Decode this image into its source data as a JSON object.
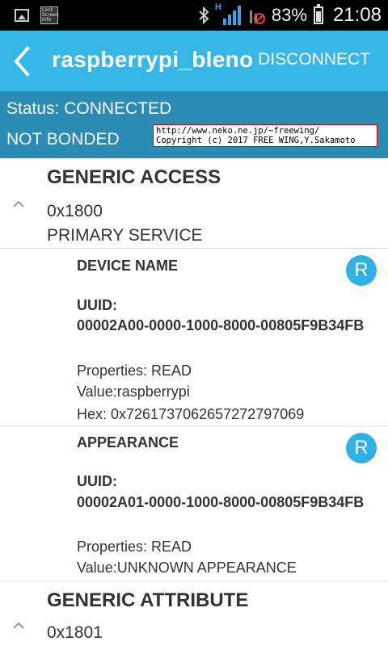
{
  "status_bar": {
    "lock_screen_text": "Lock Screen Info",
    "battery_percent": "83%",
    "time": "21:08",
    "signal_label": "H"
  },
  "app_bar": {
    "title": "raspberrypi_bleno",
    "action": "DISCONNECT"
  },
  "connection": {
    "status": "Status: CONNECTED",
    "bond": "NOT BONDED",
    "credit_line1": "http://www.neko.ne.jp/~freewing/",
    "credit_line2": "Copyright (c) 2017 FREE WING,Y.Sakamoto"
  },
  "services": [
    {
      "name": "GENERIC ACCESS",
      "uuid": "0x1800",
      "type": "PRIMARY SERVICE",
      "characteristics": [
        {
          "name": "DEVICE NAME",
          "badge": "R",
          "uuid_label": "UUID:",
          "uuid": "00002A00-0000-1000-8000-00805F9B34FB",
          "properties": "Properties: READ",
          "value": "Value:raspberrypi",
          "hex": "Hex: 0x7261737062657272797069"
        },
        {
          "name": "APPEARANCE",
          "badge": "R",
          "uuid_label": "UUID:",
          "uuid": "00002A01-0000-1000-8000-00805F9B34FB",
          "properties": "Properties: READ",
          "value": "Value:UNKNOWN APPEARANCE"
        }
      ]
    },
    {
      "name": "GENERIC ATTRIBUTE",
      "uuid": "0x1801"
    }
  ],
  "colors": {
    "app_bar": "#35b7e8",
    "status_panel": "#2a8cb4",
    "badge": "#2fb1e5"
  },
  "icons": [
    "image-icon",
    "lock-screen-icon",
    "bluetooth-icon",
    "signal-icon",
    "no-sim-icon",
    "battery-icon",
    "back-arrow-icon",
    "chevron-up-icon"
  ]
}
